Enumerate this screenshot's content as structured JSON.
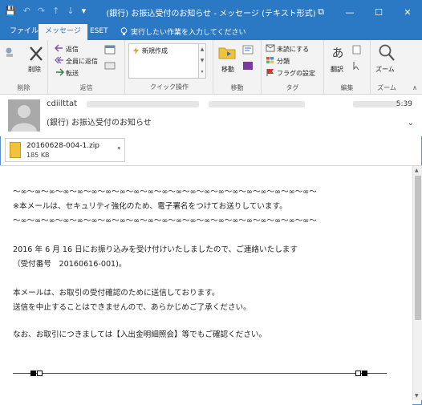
{
  "window": {
    "title": "(銀行) お振込受付のお知らせ - メッセージ (テキスト形式)",
    "controls": {
      "ribbon_options": "⧉",
      "minimize": "—",
      "maximize": "☐",
      "close": "✕"
    }
  },
  "qat": {
    "save": "💾",
    "undo": "↶",
    "redo": "↷",
    "up": "↑",
    "down": "↓",
    "more": "▾"
  },
  "tabs": [
    {
      "label": "ファイル",
      "active": false
    },
    {
      "label": "メッセージ",
      "active": true
    },
    {
      "label": "ESET",
      "active": false
    }
  ],
  "tell_me": {
    "icon": "lightbulb-icon",
    "placeholder": "実行したい作業を入力してください"
  },
  "ribbon": {
    "delete_group": {
      "label": "削除",
      "delete_button": "削除"
    },
    "reply_group": {
      "label": "返信",
      "reply": "返信",
      "reply_all": "全員に返信",
      "forward": "転送"
    },
    "quick_steps_group": {
      "label": "クイック操作",
      "new_item": "新規作成"
    },
    "move_group": {
      "label": "移動",
      "move": "移動"
    },
    "tags_group": {
      "label": "タグ",
      "unread": "未読にする",
      "categorize": "分類",
      "followup": "フラグの設定"
    },
    "edit_group": {
      "label": "編集",
      "translate": "翻訳"
    },
    "zoom_group": {
      "label": "ズーム",
      "zoom": "ズーム"
    }
  },
  "message": {
    "sender": "cdiilttat",
    "subject": "(銀行) お振込受付のお知らせ",
    "time": "5:39"
  },
  "attachment": {
    "name": "20160628-004-1.zip",
    "size": "185 KB"
  },
  "body_lines": [
    "〜∞〜∞〜∞〜∞〜∞〜∞〜∞〜∞〜∞〜∞〜∞〜∞〜∞〜∞〜∞〜∞〜∞〜∞〜∞〜∞〜∞〜",
    "※本メールは、セキュリティ強化のため、電子署名をつけてお送りしています。",
    "〜∞〜∞〜∞〜∞〜∞〜∞〜∞〜∞〜∞〜∞〜∞〜∞〜∞〜∞〜∞〜∞〜∞〜∞〜∞〜∞〜∞〜",
    "2016 年 6 月 16 日にお振り込みを受け付けいたしましたので、ご連絡いたします",
    "（受付番号　20160616-001)。",
    "本メールは、お取引の受付確認のために送信しております。",
    "送信を中止することはできませんので、あらかじめご了承ください。",
    "なお、お取引につきましては【入出金明細照会】等でもご確認ください。"
  ]
}
